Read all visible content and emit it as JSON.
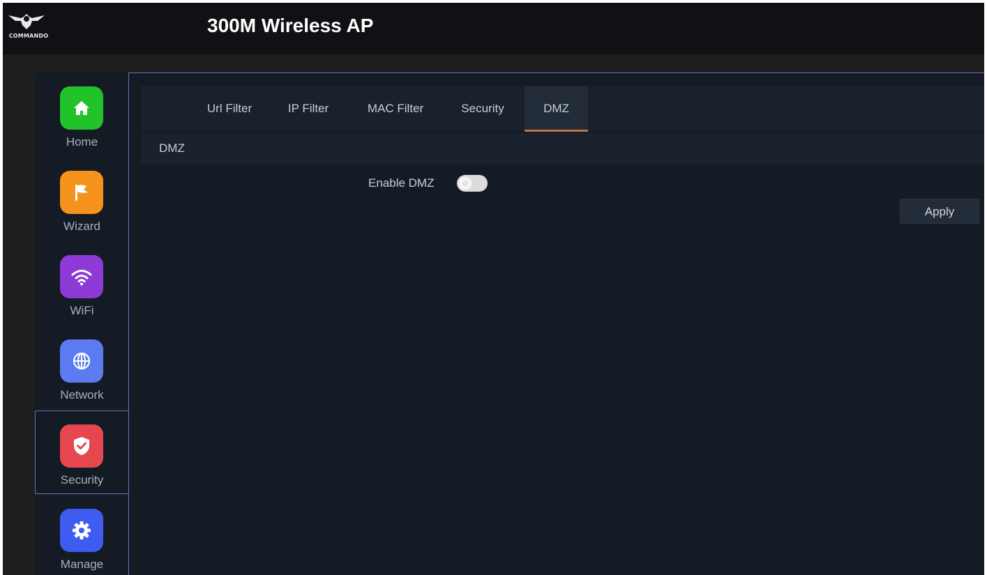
{
  "header": {
    "logo_text": "COMMANDO",
    "title": "300M Wireless AP"
  },
  "sidebar": {
    "items": [
      {
        "label": "Home",
        "icon": "home-icon",
        "color": "#22c22a"
      },
      {
        "label": "Wizard",
        "icon": "flag-icon",
        "color": "#f5931d"
      },
      {
        "label": "WiFi",
        "icon": "wifi-icon",
        "color": "#8d3ad6"
      },
      {
        "label": "Network",
        "icon": "globe-icon",
        "color": "#5b7cf0"
      },
      {
        "label": "Security",
        "icon": "shield-icon",
        "color": "#e6474e"
      },
      {
        "label": "Manage",
        "icon": "gear-icon",
        "color": "#3f5cf0"
      }
    ],
    "active": "Security"
  },
  "tabs": [
    {
      "label": "Url Filter"
    },
    {
      "label": "IP Filter"
    },
    {
      "label": "MAC Filter"
    },
    {
      "label": "Security"
    },
    {
      "label": "DMZ"
    }
  ],
  "active_tab": "DMZ",
  "section": {
    "title": "DMZ"
  },
  "form": {
    "enable_dmz_label": "Enable DMZ",
    "enable_dmz_value": false,
    "apply_label": "Apply"
  },
  "colors": {
    "accent_border": "#6b72b8",
    "active_tab_underline": "#c0734a"
  }
}
